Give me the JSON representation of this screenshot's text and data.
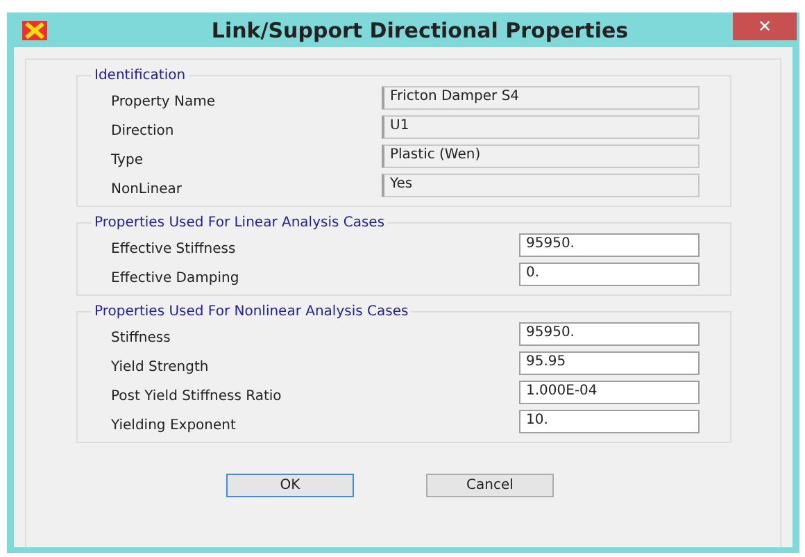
{
  "window": {
    "title": "Link/Support Directional Properties",
    "close": "✕"
  },
  "groups": [
    {
      "title": "Identification",
      "fields": [
        {
          "label": "Property Name",
          "value": "Fricton Damper S4",
          "read_only": true
        },
        {
          "label": "Direction",
          "value": "U1",
          "read_only": true
        },
        {
          "label": "Type",
          "value": "Plastic (Wen)",
          "read_only": true
        },
        {
          "label": "NonLinear",
          "value": "Yes",
          "read_only": true
        }
      ]
    },
    {
      "title": "Properties Used For Linear Analysis Cases",
      "fields": [
        {
          "label": "Effective Stiffness",
          "value": "95950.",
          "read_only": false
        },
        {
          "label": "Effective Damping",
          "value": "0.",
          "read_only": false
        }
      ]
    },
    {
      "title": "Properties Used For Nonlinear Analysis Cases",
      "fields": [
        {
          "label": "Stiffness",
          "value": "95950.",
          "read_only": false
        },
        {
          "label": "Yield Strength",
          "value": "95.95",
          "read_only": false
        },
        {
          "label": "Post Yield Stiffness Ratio",
          "value": "1.000E-04",
          "read_only": false
        },
        {
          "label": "Yielding Exponent",
          "value": "10.",
          "read_only": false
        }
      ]
    }
  ],
  "buttons": [
    {
      "label": "OK",
      "default": true
    },
    {
      "label": "Cancel",
      "default": false
    }
  ]
}
